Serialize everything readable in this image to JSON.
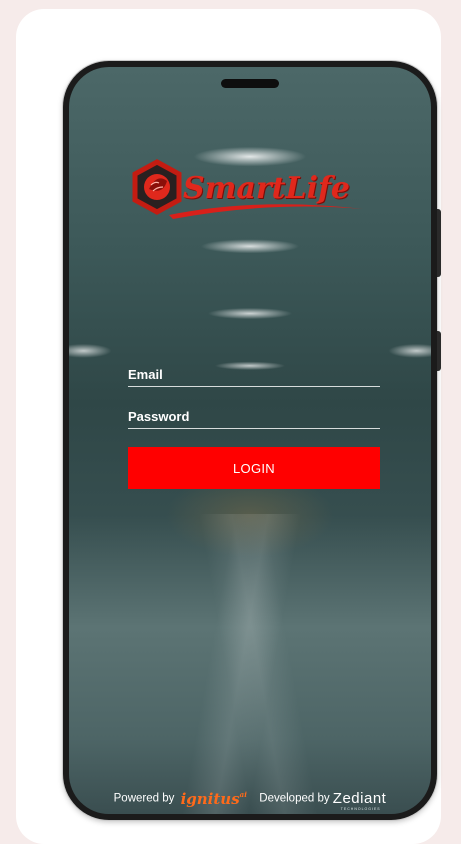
{
  "app": {
    "logo_text": "SmartLife",
    "brand_color": "#e0281c"
  },
  "form": {
    "email_label": "Email",
    "password_label": "Password",
    "login_label": "LOGIN",
    "login_color": "#ff0000"
  },
  "footer": {
    "powered_by": "Powered by",
    "powered_brand": "ignitus",
    "powered_brand_mark": "ai",
    "developed_by": "Developed by",
    "developer_brand": "Zediant",
    "developer_sub": "TECHNOLOGIES"
  },
  "icons": {
    "logo": "hexagon-brain-leaf-icon"
  }
}
